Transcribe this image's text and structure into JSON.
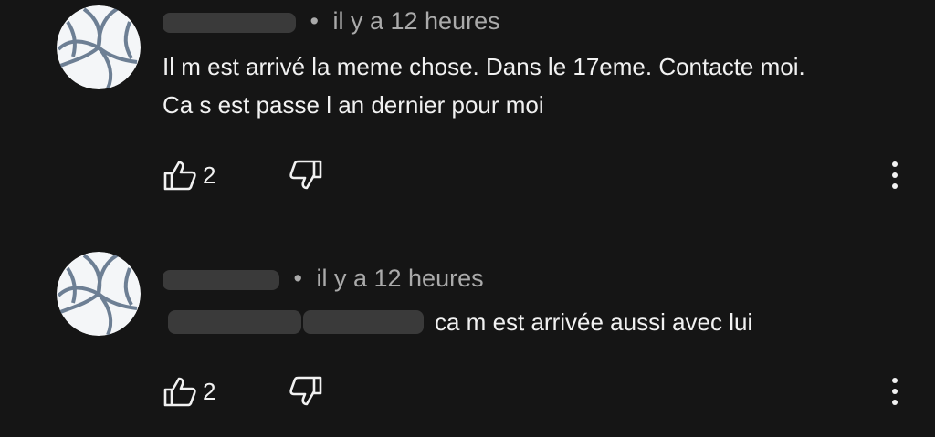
{
  "comments": [
    {
      "time": "il y a 12 heures",
      "text_lines": [
        "Il m est arrivé la meme chose. Dans le 17eme. Contacte moi.",
        "Ca s est passe l an dernier pour moi"
      ],
      "likes": "2",
      "icons": {
        "avatar": "volleyball-icon",
        "like": "thumb-up-icon",
        "dislike": "thumb-down-icon",
        "more": "more-vertical-icon"
      }
    },
    {
      "time": "il y a 12 heures",
      "text": "ca m est arrivée aussi avec lui",
      "likes": "2",
      "icons": {
        "avatar": "volleyball-icon",
        "like": "thumb-up-icon",
        "dislike": "thumb-down-icon",
        "more": "more-vertical-icon"
      }
    }
  ],
  "colors": {
    "background": "#151515",
    "text": "#f1f1f1",
    "secondary_text": "#aaaaaa",
    "redaction": "#3a3a3a"
  }
}
